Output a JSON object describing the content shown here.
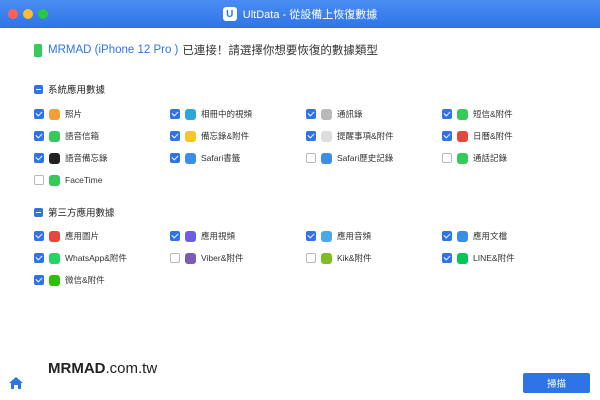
{
  "window": {
    "title": "UltData - 從設備上恢復數據",
    "logo_letter": "U",
    "dots": [
      "#ff5f57",
      "#febc2e",
      "#28c840"
    ]
  },
  "headline": {
    "device": "MRMAD (iPhone 12 Pro )",
    "text": "已連接！請選擇你想要恢復的數據類型"
  },
  "sections": [
    {
      "title": "系統應用數據",
      "items": [
        {
          "label": "照片",
          "checked": true,
          "icon": "photos-icon",
          "color": "#f4a03a"
        },
        {
          "label": "相冊中的視頻",
          "checked": true,
          "icon": "video-icon",
          "color": "#2aa8d8"
        },
        {
          "label": "通訊錄",
          "checked": true,
          "icon": "contacts-icon",
          "color": "#b9b9b9"
        },
        {
          "label": "短信&附件",
          "checked": true,
          "icon": "messages-icon",
          "color": "#36c95b"
        },
        {
          "label": "語音信箱",
          "checked": true,
          "icon": "voicemail-icon",
          "color": "#36c95b"
        },
        {
          "label": "備忘錄&附件",
          "checked": true,
          "icon": "notes-icon",
          "color": "#f7c623"
        },
        {
          "label": "提醒事項&附件",
          "checked": true,
          "icon": "reminders-icon",
          "color": "#dddddd"
        },
        {
          "label": "日曆&附件",
          "checked": true,
          "icon": "calendar-icon",
          "color": "#e8453c"
        },
        {
          "label": "語音備忘錄",
          "checked": true,
          "icon": "voice-memo-icon",
          "color": "#222222"
        },
        {
          "label": "Safari書籤",
          "checked": true,
          "icon": "safari-icon",
          "color": "#3a8ee6"
        },
        {
          "label": "Safari歷史記錄",
          "checked": false,
          "icon": "safari-history-icon",
          "color": "#3a8ee6"
        },
        {
          "label": "通話記錄",
          "checked": false,
          "icon": "phone-icon",
          "color": "#36c95b"
        },
        {
          "label": "FaceTime",
          "checked": false,
          "icon": "facetime-icon",
          "color": "#36c95b"
        }
      ]
    },
    {
      "title": "第三方應用數據",
      "items": [
        {
          "label": "應用圖片",
          "checked": true,
          "icon": "app-photos-icon",
          "color": "#e8453c"
        },
        {
          "label": "應用視頻",
          "checked": true,
          "icon": "app-video-icon",
          "color": "#6d5ce8"
        },
        {
          "label": "應用音頻",
          "checked": true,
          "icon": "app-audio-icon",
          "color": "#4aa8e8"
        },
        {
          "label": "應用文檔",
          "checked": true,
          "icon": "app-document-icon",
          "color": "#3a8ee6"
        },
        {
          "label": "WhatsApp&附件",
          "checked": true,
          "icon": "whatsapp-icon",
          "color": "#25d366"
        },
        {
          "label": "Viber&附件",
          "checked": false,
          "icon": "viber-icon",
          "color": "#7d5ab8"
        },
        {
          "label": "Kik&附件",
          "checked": false,
          "icon": "kik-icon",
          "color": "#82bc23"
        },
        {
          "label": "LINE&附件",
          "checked": true,
          "icon": "line-icon",
          "color": "#06c755"
        },
        {
          "label": "微信&附件",
          "checked": true,
          "icon": "wechat-icon",
          "color": "#2dc100"
        }
      ]
    }
  ],
  "footer": {
    "watermark_bold": "MRMAD",
    "watermark_rest": ".com.tw",
    "scan_label": "掃描",
    "accent": "#2f74e6"
  }
}
